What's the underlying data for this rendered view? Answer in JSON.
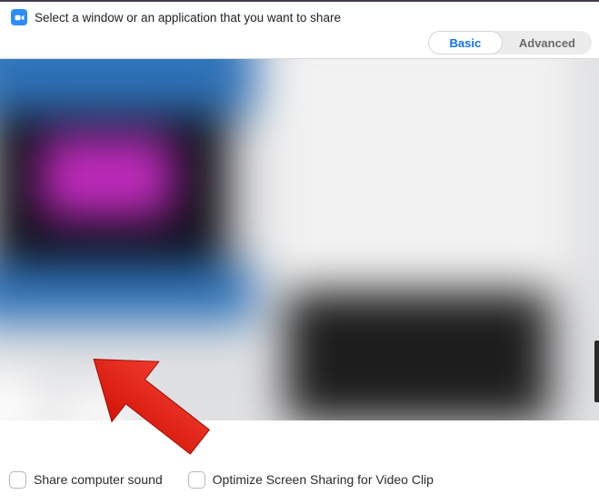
{
  "header": {
    "title": "Select a window or an application that you want to share"
  },
  "tabs": {
    "basic_label": "Basic",
    "advanced_label": "Advanced"
  },
  "options": {
    "share_sound_label": "Share computer sound",
    "optimize_video_label": "Optimize Screen Sharing for Video Clip"
  },
  "colors": {
    "primary": "#0e71eb",
    "arrow": "#e4261b"
  }
}
